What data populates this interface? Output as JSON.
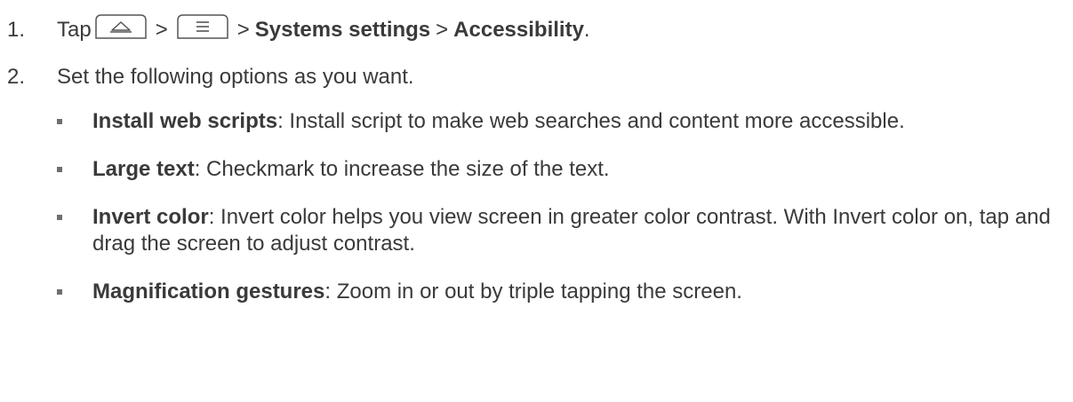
{
  "steps": [
    {
      "number": "1.",
      "prefix": "Tap",
      "icon1": "home-key-icon",
      "icon2": "menu-key-icon",
      "sep": ">",
      "bold1": "Systems settings",
      "bold2": "Accessibility",
      "suffix": "."
    },
    {
      "number": "2.",
      "text": "Set the following options as you want."
    }
  ],
  "options": [
    {
      "term": "Install web scripts",
      "desc": ": Install script to make web searches and content more accessible."
    },
    {
      "term": "Large text",
      "desc": ": Checkmark to increase the size of the text."
    },
    {
      "term": "Invert color",
      "desc": ": Invert color helps you view screen in greater color contrast. With Invert color on, tap and drag the screen to adjust contrast."
    },
    {
      "term": "Magnification gestures",
      "desc": ": Zoom in or out by triple tapping the screen."
    }
  ]
}
